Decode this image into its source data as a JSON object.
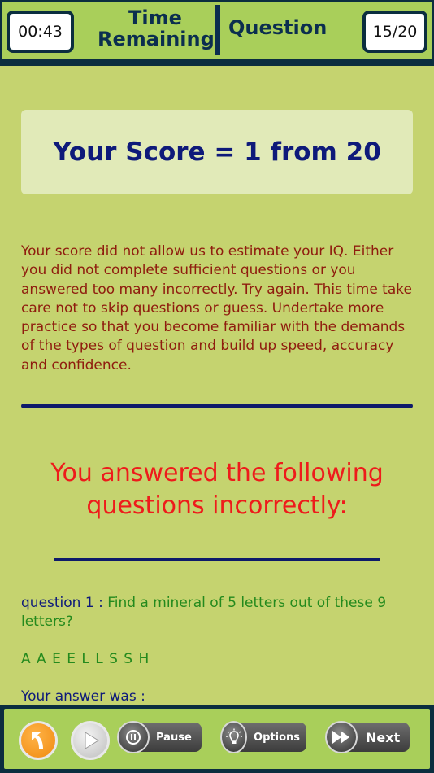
{
  "header": {
    "timer": "00:43",
    "time_line1": "Time",
    "time_line2": "Remaining",
    "question_label": "Question",
    "question_count": "15/20"
  },
  "score": {
    "title": "Your Score = 1 from 20"
  },
  "message": "Your score did not allow us to estimate your IQ. Either you did not complete sufficient questions or you answered too many incorrectly. Try again. This time take care not to skip questions or guess. Undertake more practice so that you become familiar with the demands of the types of question and build up speed, accuracy and confidence.",
  "incorrect": {
    "title": "You answered the following questions incorrectly:",
    "question_label": "question 1 :",
    "question_text": "Find a mineral of 5 letters out of these 9 letters?",
    "letters": "A A E E L L S S H",
    "answer_label": "Your answer was :"
  },
  "toolbar": {
    "pause_label": "Pause",
    "options_label": "Options",
    "next_label": "Next"
  },
  "colors": {
    "background": "#c5d36f",
    "header": "#a9cf5a",
    "dark_navy": "#0b2e3f",
    "score_text": "#0e1a7a",
    "message_text": "#8f1c0e",
    "incorrect_title": "#ee1b1b",
    "question_text": "#248a1d"
  },
  "icons": [
    "back-arrow-icon",
    "play-icon",
    "pause-icon",
    "lightbulb-icon",
    "fast-forward-icon"
  ]
}
